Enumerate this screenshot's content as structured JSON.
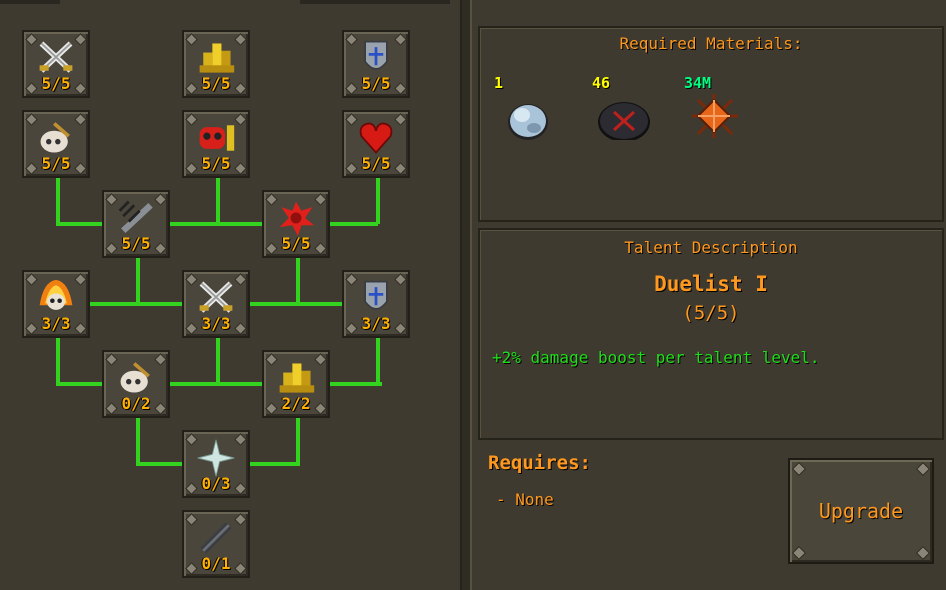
{
  "colors": {
    "level_text": "#ffb000",
    "header_text": "#ff981f",
    "effect_text": "#20dd1a",
    "connector": "#33d21f",
    "quantity_yellow": "#ffff00",
    "quantity_green": "#00ff80"
  },
  "tree": {
    "nodes": [
      {
        "id": "n1",
        "icon": "crossed-swords-icon",
        "level": "5/5"
      },
      {
        "id": "n2",
        "icon": "gold-coins-icon",
        "level": "5/5"
      },
      {
        "id": "n3",
        "icon": "blue-shield-icon",
        "level": "5/5"
      },
      {
        "id": "n4",
        "icon": "skull-sword-icon",
        "level": "5/5"
      },
      {
        "id": "n5",
        "icon": "red-skull-coins-icon",
        "level": "5/5"
      },
      {
        "id": "n6",
        "icon": "red-heart-icon",
        "level": "5/5"
      },
      {
        "id": "n7",
        "icon": "slash-sword-icon",
        "level": "5/5"
      },
      {
        "id": "n8",
        "icon": "blood-splat-icon",
        "level": "5/5"
      },
      {
        "id": "n9",
        "icon": "flaming-skull-icon",
        "level": "3/3"
      },
      {
        "id": "n10",
        "icon": "crossed-swords-icon",
        "level": "3/3"
      },
      {
        "id": "n11",
        "icon": "blue-shield-icon",
        "level": "3/3"
      },
      {
        "id": "n12",
        "icon": "skull-sword-icon",
        "level": "0/2"
      },
      {
        "id": "n13",
        "icon": "gold-coins-icon",
        "level": "2/2"
      },
      {
        "id": "n14",
        "icon": "sparkle-star-icon",
        "level": "0/3"
      },
      {
        "id": "n15",
        "icon": "dark-sword-icon",
        "level": "0/1"
      }
    ]
  },
  "materials": {
    "title": "Required Materials:",
    "items": [
      {
        "icon": "white-orb-icon",
        "quantity": "1"
      },
      {
        "icon": "dark-rune-stone-icon",
        "quantity": "46"
      },
      {
        "icon": "spiked-orange-orb-icon",
        "quantity": "34M"
      }
    ]
  },
  "description": {
    "title": "Talent Description",
    "name": "Duelist I",
    "level": "(5/5)",
    "effect": "+2% damage boost per talent level."
  },
  "requires": {
    "heading": "Requires:",
    "items": [
      "- None"
    ]
  },
  "upgrade_button": {
    "label": "Upgrade"
  }
}
